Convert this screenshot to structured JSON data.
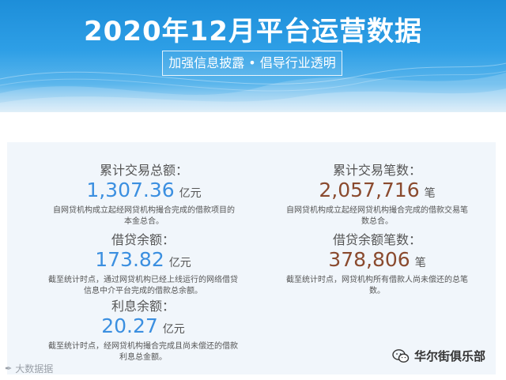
{
  "header": {
    "title": "2020年12月平台运营数据",
    "subtitle": "加强信息披露 • 倡导行业透明"
  },
  "stats": {
    "total_amount": {
      "label": "累计交易总额：",
      "value": "1,307.36",
      "unit": "亿元",
      "desc_lines": [
        "自网贷机构成立起经网贷机构撮合完成的借款项目的",
        "本金总合。"
      ]
    },
    "total_count": {
      "label": "累计交易笔数：",
      "value": "2,057,716",
      "unit": "笔",
      "desc_lines": [
        "自网贷机构成立起经网贷机构撮合完成的借款交易笔",
        "数总合。"
      ]
    },
    "loan_balance": {
      "label": "借贷余额：",
      "value": "173.82",
      "unit": "亿元",
      "desc_lines": [
        "截至统计时点，通过网贷机构已经上线运行的网络借贷",
        "信息中介平台完成的借款总余额。"
      ]
    },
    "loan_balance_count": {
      "label": "借贷余额笔数：",
      "value": "378,806",
      "unit": "笔",
      "desc_lines": [
        "截至统计时点，网贷机构所有借款人尚未偿还的总笔",
        "数。"
      ]
    },
    "interest_balance": {
      "label": "利息余额：",
      "value": "20.27",
      "unit": "亿元",
      "desc_lines": [
        "截至统计时点，经网贷机构撮合完成且尚未偿还的借款",
        "利息总金额。"
      ]
    }
  },
  "footer": {
    "left_watermark": "大数据据",
    "right_brand": "华尔街俱乐部"
  },
  "colors": {
    "banner": "#2e9fe6",
    "value_blue": "#3b8fe0",
    "value_brown": "#8a4a2e",
    "panel_bg": "#f1f6fb"
  }
}
